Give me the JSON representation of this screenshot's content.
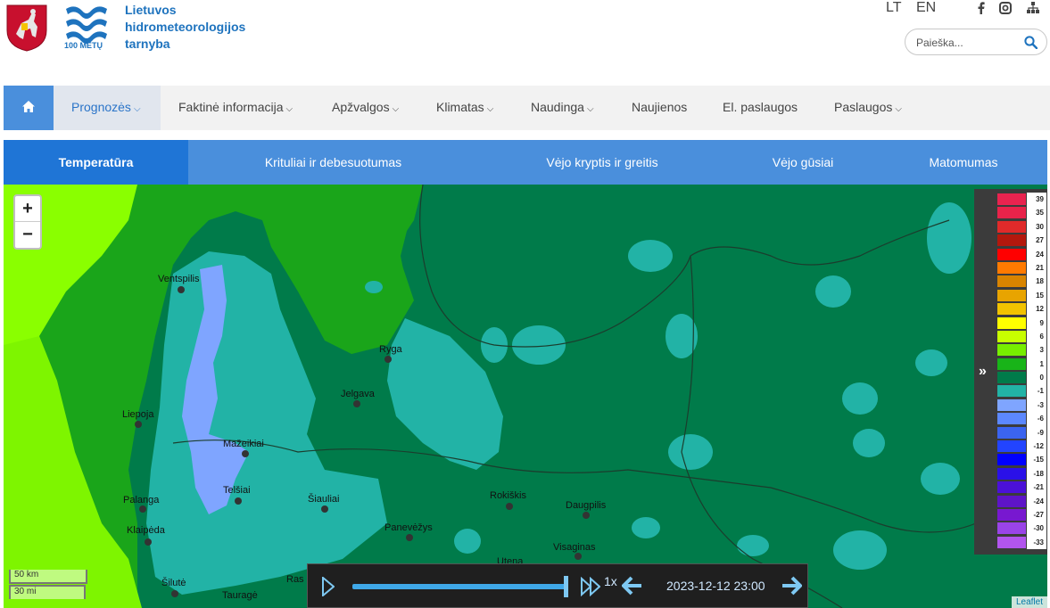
{
  "header": {
    "org_line1": "Lietuvos",
    "org_line2": "hidrometeorologijos",
    "org_line3": "tarnyba",
    "logo_caption": "100 METŲ",
    "lang_lt": "LT",
    "lang_en": "EN",
    "search_placeholder": "Paieška...",
    "brand_color": "#1e73be"
  },
  "nav": {
    "items": [
      {
        "label": "Prognozės"
      },
      {
        "label": "Faktinė informacija"
      },
      {
        "label": "Apžvalgos"
      },
      {
        "label": "Klimatas"
      },
      {
        "label": "Naudinga"
      },
      {
        "label": "Naujienos"
      },
      {
        "label": "El. paslaugos"
      },
      {
        "label": "Paslaugos"
      }
    ]
  },
  "tabs": [
    {
      "label": "Temperatūra"
    },
    {
      "label": "Krituliai ir debesuotumas"
    },
    {
      "label": "Vėjo kryptis ir greitis"
    },
    {
      "label": "Vėjo gūsiai"
    },
    {
      "label": "Matomumas"
    }
  ],
  "map": {
    "zoom_in": "+",
    "zoom_out": "−",
    "cities": [
      "Ventspilis",
      "Ryga",
      "Jelgava",
      "Liepoja",
      "Mažeikiai",
      "Telšiai",
      "Palanga",
      "Šiauliai",
      "Rokiškis",
      "Daugpilis",
      "Klaipėda",
      "Panevėžys",
      "Visaginas",
      "Utena",
      "Šilutė",
      "Tauragė",
      "Ras"
    ],
    "scale_km": "50 km",
    "scale_mi": "30 mi",
    "attribution": "Leaflet"
  },
  "legend": {
    "labels": [
      "39",
      "35",
      "30",
      "27",
      "24",
      "21",
      "18",
      "15",
      "12",
      "9",
      "6",
      "3",
      "1",
      "0",
      "-1",
      "-3",
      "-6",
      "-9",
      "-12",
      "-15",
      "-18",
      "-21",
      "-24",
      "-27",
      "-30",
      "-33"
    ],
    "colors": [
      "#e8234f",
      "#e8234a",
      "#e02a2a",
      "#b3180d",
      "#ff0000",
      "#ff7a00",
      "#d88400",
      "#e8a400",
      "#f2c300",
      "#ffff00",
      "#c8ff00",
      "#77ee00",
      "#18b418",
      "#007b4a",
      "#22b3a6",
      "#7fa5ff",
      "#5c88ff",
      "#3b64f0",
      "#2244ff",
      "#0000ff",
      "#2a10e8",
      "#4b10d8",
      "#5e14c8",
      "#7818d0",
      "#9a44e8",
      "#b255ee"
    ]
  },
  "player": {
    "speed": "1x",
    "datetime": "2023-12-12 23:00",
    "progress": 1.0
  }
}
